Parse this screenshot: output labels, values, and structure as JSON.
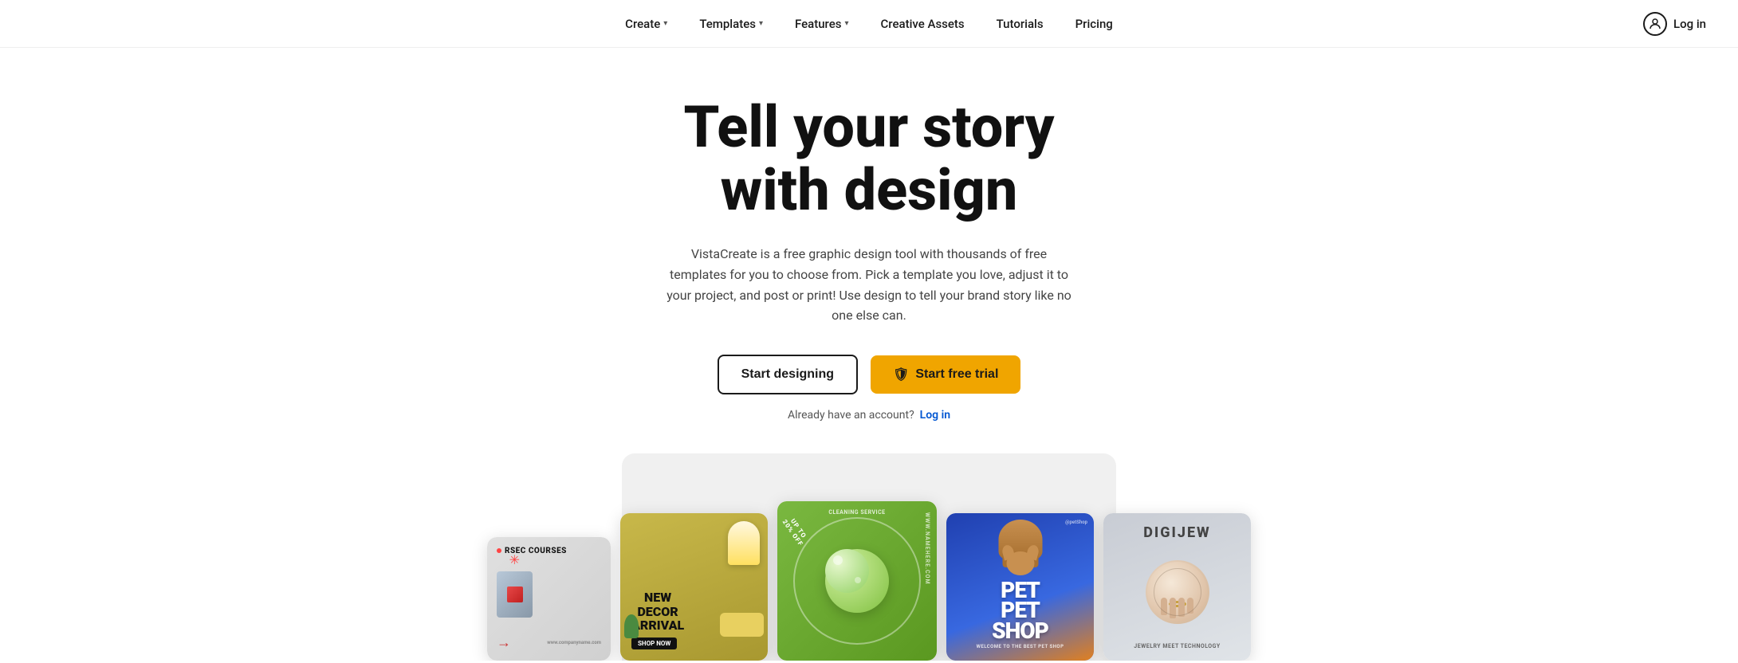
{
  "nav": {
    "items": [
      {
        "id": "create",
        "label": "Create",
        "hasDropdown": true
      },
      {
        "id": "templates",
        "label": "Templates",
        "hasDropdown": true
      },
      {
        "id": "features",
        "label": "Features",
        "hasDropdown": true
      },
      {
        "id": "creative-assets",
        "label": "Creative Assets",
        "hasDropdown": false
      },
      {
        "id": "tutorials",
        "label": "Tutorials",
        "hasDropdown": false
      },
      {
        "id": "pricing",
        "label": "Pricing",
        "hasDropdown": false
      }
    ],
    "login_label": "Log in"
  },
  "hero": {
    "title_line1": "Tell your story",
    "title_line2": "with design",
    "subtitle": "VistaCreate is a free graphic design tool with thousands of free templates for you to choose from. Pick a template you love, adjust it to your project, and post or print! Use design to tell your brand story like no one else can.",
    "btn_designing": "Start designing",
    "btn_trial_icon": "🛡",
    "btn_trial": "Start free trial",
    "account_text": "Already have an account?",
    "login_link": "Log in"
  },
  "cards": [
    {
      "id": "card-1",
      "type": "rsec",
      "title": "RSEC COURSES",
      "url": "www.companyname.com",
      "size": "small"
    },
    {
      "id": "card-2",
      "type": "decor",
      "title_line1": "NEW",
      "title_line2": "DECOR",
      "title_line3": "ARRIVAL",
      "shop_btn": "SHOP NOW",
      "size": "medium"
    },
    {
      "id": "card-3",
      "type": "cleaning",
      "percent": "UP TO 20% OFF",
      "service": "CLEANING SERVICE",
      "url": "www.namehere.com",
      "size": "large"
    },
    {
      "id": "card-4",
      "type": "petshop",
      "handle": "@petShop",
      "title_line1": "PET",
      "title_line2": "PET",
      "title_line3": "SHOP",
      "subtitle": "WELCOME TO THE BEST PET SHOP",
      "size": "medium"
    },
    {
      "id": "card-5",
      "type": "digijew",
      "title": "DIGIJEW",
      "subtitle": "JEWELRY MEET TECHNOLOGY",
      "size": "medium"
    }
  ],
  "colors": {
    "accent_blue": "#0056d2",
    "accent_gold": "#f0a500",
    "text_dark": "#111111",
    "text_mid": "#444444",
    "text_light": "#666666"
  }
}
